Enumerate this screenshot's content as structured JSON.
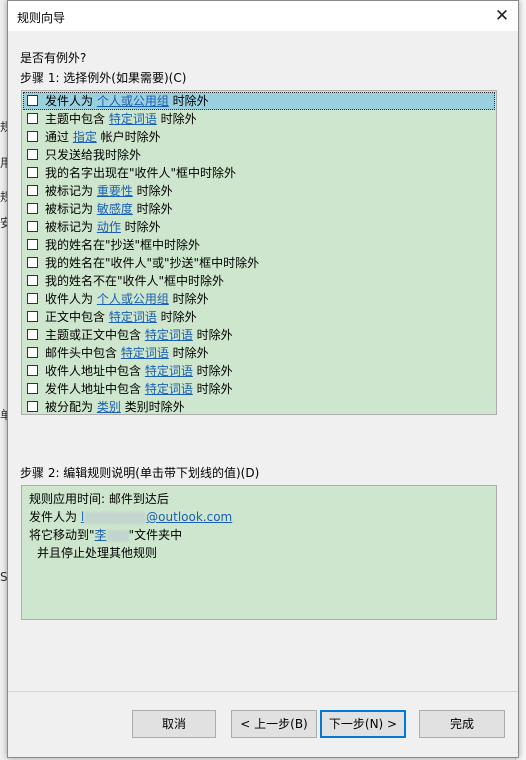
{
  "dialog": {
    "title": "规则向导"
  },
  "background": {
    "fragments": [
      "规",
      "用",
      "规",
      "安",
      "单",
      "S"
    ]
  },
  "question": "是否有例外?",
  "step1_label": "步骤 1: 选择例外(如果需要)(C)",
  "exceptions": [
    {
      "before": "发件人为 ",
      "link": "个人或公用组",
      "after": " 时除外",
      "checked": false,
      "selected": true
    },
    {
      "before": "主题中包含 ",
      "link": "特定词语",
      "after": " 时除外",
      "checked": false
    },
    {
      "before": "通过 ",
      "link": "指定",
      "after": " 帐户时除外",
      "checked": false
    },
    {
      "before": "只发送给我时除外",
      "link": "",
      "after": "",
      "checked": false
    },
    {
      "before": "我的名字出现在\"收件人\"框中时除外",
      "link": "",
      "after": "",
      "checked": false
    },
    {
      "before": "被标记为 ",
      "link": "重要性",
      "after": " 时除外",
      "checked": false
    },
    {
      "before": "被标记为 ",
      "link": "敏感度",
      "after": " 时除外",
      "checked": false
    },
    {
      "before": "被标记为 ",
      "link": "动作",
      "after": " 时除外",
      "checked": false
    },
    {
      "before": "我的姓名在\"抄送\"框中时除外",
      "link": "",
      "after": "",
      "checked": false
    },
    {
      "before": "我的姓名在\"收件人\"或\"抄送\"框中时除外",
      "link": "",
      "after": "",
      "checked": false
    },
    {
      "before": "我的姓名不在\"收件人\"框中时除外",
      "link": "",
      "after": "",
      "checked": false
    },
    {
      "before": "收件人为 ",
      "link": "个人或公用组",
      "after": " 时除外",
      "checked": false
    },
    {
      "before": "正文中包含 ",
      "link": "特定词语",
      "after": " 时除外",
      "checked": false
    },
    {
      "before": "主题或正文中包含 ",
      "link": "特定词语",
      "after": " 时除外",
      "checked": false
    },
    {
      "before": "邮件头中包含 ",
      "link": "特定词语",
      "after": " 时除外",
      "checked": false
    },
    {
      "before": "收件人地址中包含 ",
      "link": "特定词语",
      "after": " 时除外",
      "checked": false
    },
    {
      "before": "发件人地址中包含 ",
      "link": "特定词语",
      "after": " 时除外",
      "checked": false
    },
    {
      "before": "被分配为 ",
      "link": "类别",
      "after": " 类别时除外",
      "checked": false
    }
  ],
  "step2_label": "步骤 2: 编辑规则说明(单击带下划线的值)(D)",
  "description": {
    "line1": "规则应用时间: 邮件到达后",
    "line2_prefix": "发件人为 ",
    "line2_link_start": "l",
    "line2_link_end": "@outlook.com",
    "line3_prefix": "将它移动到\"",
    "line3_link": "李",
    "line3_suffix": "\"文件夹中",
    "line4": "并且停止处理其他规则"
  },
  "buttons": {
    "cancel": "取消",
    "back": "< 上一步(B)",
    "next": "下一步(N) >",
    "finish": "完成"
  },
  "colors": {
    "list_bg": "#cde6cd",
    "selection": "#9ad0de",
    "link": "#1a5fb4",
    "focus": "#0078d7"
  }
}
